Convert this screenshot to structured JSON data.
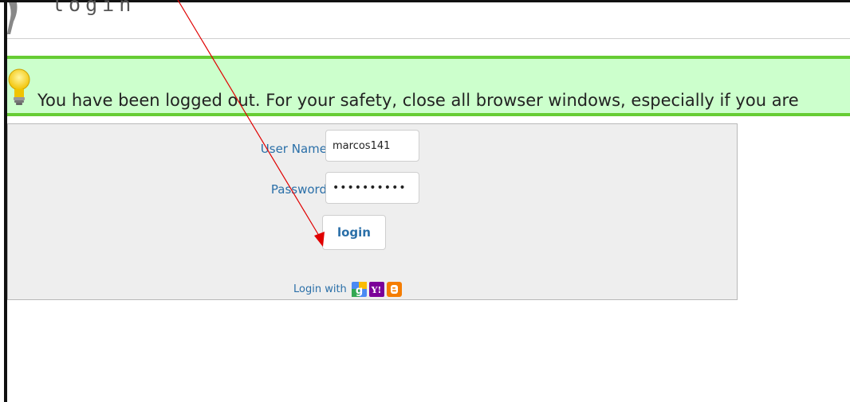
{
  "header": {
    "title": "login"
  },
  "notice": {
    "message": "You have been logged out. For your safety, close all browser windows, especially if you are"
  },
  "login_form": {
    "username_label": "User Name",
    "username_value": "marcos141",
    "password_label": "Password",
    "password_value": "••••••••••",
    "login_button": "login",
    "login_with_label": "Login with",
    "providers": [
      {
        "name": "google-icon",
        "color": "#4a8af4"
      },
      {
        "name": "yahoo-icon",
        "color": "#7b0099"
      },
      {
        "name": "blogger-icon",
        "color": "#f57d00"
      }
    ]
  },
  "annotation": {
    "arrow_color": "#e00000"
  }
}
